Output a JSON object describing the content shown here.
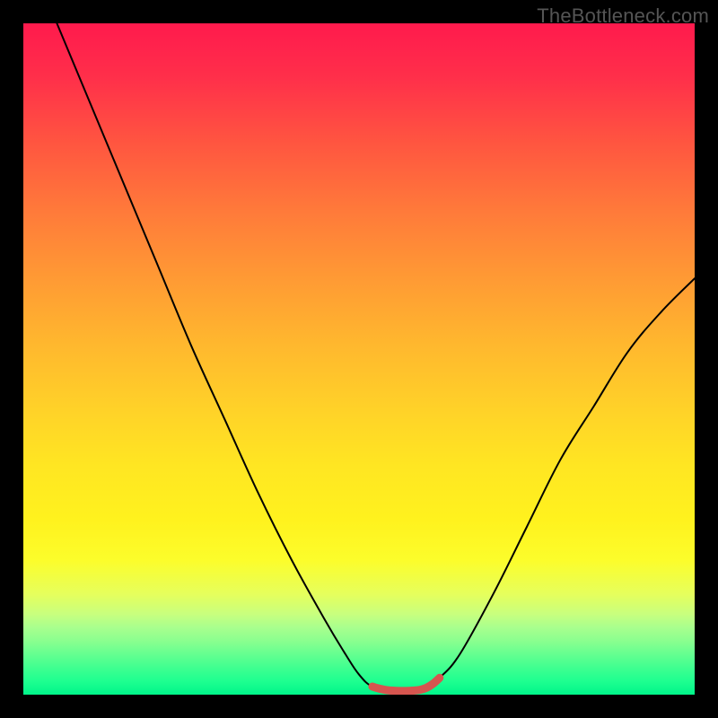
{
  "watermark": "TheBottleneck.com",
  "colors": {
    "background": "#000000",
    "curve": "#000000",
    "marker": "#d6554f"
  },
  "chart_data": {
    "type": "line",
    "title": "",
    "xlabel": "",
    "ylabel": "",
    "xlim": [
      0,
      100
    ],
    "ylim": [
      0,
      100
    ],
    "grid": false,
    "legend": false,
    "series": [
      {
        "name": "bottleneck-curve",
        "x": [
          0,
          5,
          10,
          15,
          20,
          25,
          30,
          35,
          40,
          45,
          48,
          50,
          52,
          55,
          58,
          60,
          62,
          65,
          70,
          75,
          80,
          85,
          90,
          95,
          100
        ],
        "y": [
          112,
          100,
          88,
          76,
          64,
          52,
          41,
          30,
          20,
          11,
          6,
          3,
          1.2,
          0.6,
          0.6,
          1.0,
          2.5,
          6,
          15,
          25,
          35,
          43,
          51,
          57,
          62
        ]
      },
      {
        "name": "optimal-range-marker",
        "x": [
          52,
          53,
          54,
          55,
          56,
          57,
          58,
          59,
          60,
          61,
          62
        ],
        "y": [
          1.2,
          0.9,
          0.7,
          0.6,
          0.55,
          0.55,
          0.6,
          0.7,
          1.0,
          1.6,
          2.5
        ]
      }
    ],
    "annotations": []
  }
}
